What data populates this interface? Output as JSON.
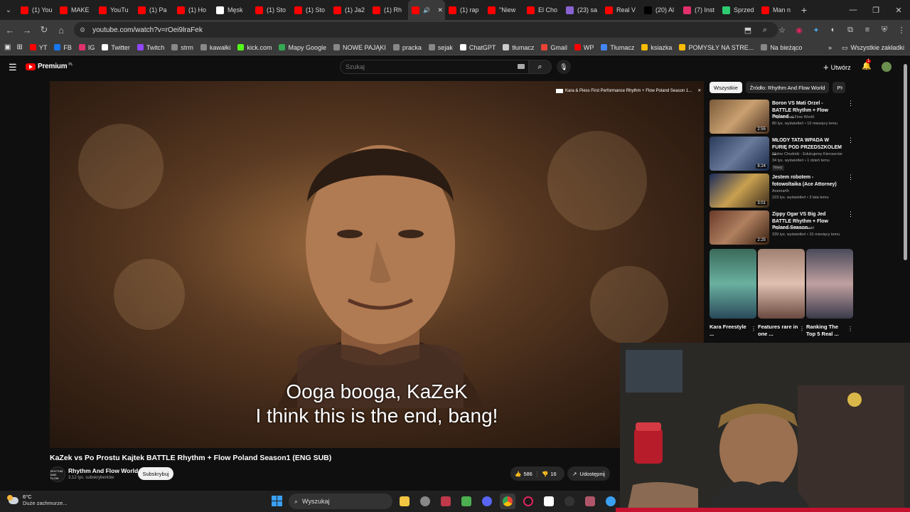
{
  "browser": {
    "tabs": [
      {
        "label": "(1) You",
        "color": "#ff0000"
      },
      {
        "label": "MAKE",
        "color": "#ff0000"
      },
      {
        "label": "YouTu",
        "color": "#ff0000"
      },
      {
        "label": "(1) Pa",
        "color": "#ff0000"
      },
      {
        "label": "(1) Ho",
        "color": "#ff0000"
      },
      {
        "label": "Męsk",
        "color": "#ffffff"
      },
      {
        "label": "(1) Sto",
        "color": "#ff0000"
      },
      {
        "label": "(1) Sto",
        "color": "#ff0000"
      },
      {
        "label": "(1) Ja2",
        "color": "#ff0000"
      },
      {
        "label": "(1) Rh",
        "color": "#ff0000"
      },
      {
        "label": "",
        "color": "#ff0000",
        "active": true
      },
      {
        "label": "(1) rap",
        "color": "#ff0000"
      },
      {
        "label": "\"Niew",
        "color": "#ff0000"
      },
      {
        "label": "El Cho",
        "color": "#ff0000"
      },
      {
        "label": "(23) sa",
        "color": "#8a63d2"
      },
      {
        "label": "Real V",
        "color": "#ff0000"
      },
      {
        "label": "(20) Al",
        "color": "#000000"
      },
      {
        "label": "(7) Inst",
        "color": "#e1306c"
      },
      {
        "label": "Sprzed",
        "color": "#2ecc71"
      },
      {
        "label": "Man n",
        "color": "#ff0000"
      }
    ],
    "url": "youtube.com/watch?v=rOei9lraFek",
    "bookmarks": [
      {
        "label": "YT",
        "color": "#ff0000"
      },
      {
        "label": "FB",
        "color": "#1877f2"
      },
      {
        "label": "IG",
        "color": "#e1306c"
      },
      {
        "label": "Twitter",
        "color": "#ffffff"
      },
      {
        "label": "Twitch",
        "color": "#9146ff"
      },
      {
        "label": "strm",
        "color": "#888888"
      },
      {
        "label": "kawałki",
        "color": "#888888"
      },
      {
        "label": "kick.com",
        "color": "#53fc18"
      },
      {
        "label": "Mapy Google",
        "color": "#34a853"
      },
      {
        "label": "NOWE PAJĄKI",
        "color": "#888888"
      },
      {
        "label": "pracka",
        "color": "#888888"
      },
      {
        "label": "sejak",
        "color": "#888888"
      },
      {
        "label": "ChatGPT",
        "color": "#ffffff"
      },
      {
        "label": "tłumacz",
        "color": "#cccccc"
      },
      {
        "label": "Gmail",
        "color": "#ea4335"
      },
      {
        "label": "WP",
        "color": "#ff0000"
      },
      {
        "label": "Tłumacz",
        "color": "#4285f4"
      },
      {
        "label": "ksiazka",
        "color": "#fbbc05"
      },
      {
        "label": "POMYSŁY NA STRE...",
        "color": "#fbbc05"
      },
      {
        "label": "Na bieżąco",
        "color": "#888888"
      }
    ],
    "all_bookmarks": "Wszystkie zakładki"
  },
  "youtube": {
    "logo": "Premium",
    "region": "PL",
    "search_placeholder": "Szukaj",
    "create": "Utwórz",
    "notifications": "1",
    "video": {
      "overlay_title": "Kara & Piess First Performance Rhythm + Flow Poland Season 1...",
      "subtitle_line1": "Ooga booga, KaZeK",
      "subtitle_line2": "I think this is the end, bang!",
      "title": "KaZek vs Po Prostu Kajtek BATTLE Rhythm + Flow Poland Season1 (ENG SUB)",
      "channel": "Rhythm And Flow World",
      "channel_avatar": "RHYTHM AND FLOW",
      "subscribers": "3,12 tys. subskrybentów",
      "subscribe": "Subskrybuj",
      "likes": "586",
      "dislikes": "16",
      "share": "Udostępnij"
    },
    "chips": [
      "Wszystkie",
      "Źródło: Rhythm And Flow World",
      "P"
    ],
    "recommendations": [
      {
        "title": "Boron VS Mati Orzel - BATTLE Rhythm + Flow Poland ...",
        "channel": "Rhythm And Flow World",
        "meta": "80 tys. wyświetleń • 10 miesięcy temu",
        "duration": "2:55",
        "badge": ""
      },
      {
        "title": "MŁODY TATA WPADA W FURIĘ POD PRZEDSZKOLEM ...",
        "channel": "Wolne Chodniki - Edukujemy Kierowców",
        "meta": "34 tys. wyświetleń • 1 dzień temu",
        "duration": "8:24",
        "badge": "Nowy"
      },
      {
        "title": "Jestem robotem - fotowoltaika (Ace Attorney)",
        "channel": "Anemarth",
        "meta": "223 tys. wyświetleń • 3 lata temu",
        "duration": "3:01",
        "badge": ""
      },
      {
        "title": "Zippy Ogar VS Big Jed BATTLE Rhythm + Flow Poland Season...",
        "channel": "Rhythm And Flow World",
        "meta": "339 tys. wyświetleń • 10 miesięcy temu",
        "duration": "2:25",
        "badge": ""
      }
    ],
    "shorts": [
      {
        "title": "Kara Freestyle ..."
      },
      {
        "title": "Features rare in one ..."
      },
      {
        "title": "Ranking The Top 5 Real ..."
      }
    ]
  },
  "taskbar": {
    "temperature": "6°C",
    "weather": "Duże zachmurze...",
    "search": "Wyszukaj"
  }
}
